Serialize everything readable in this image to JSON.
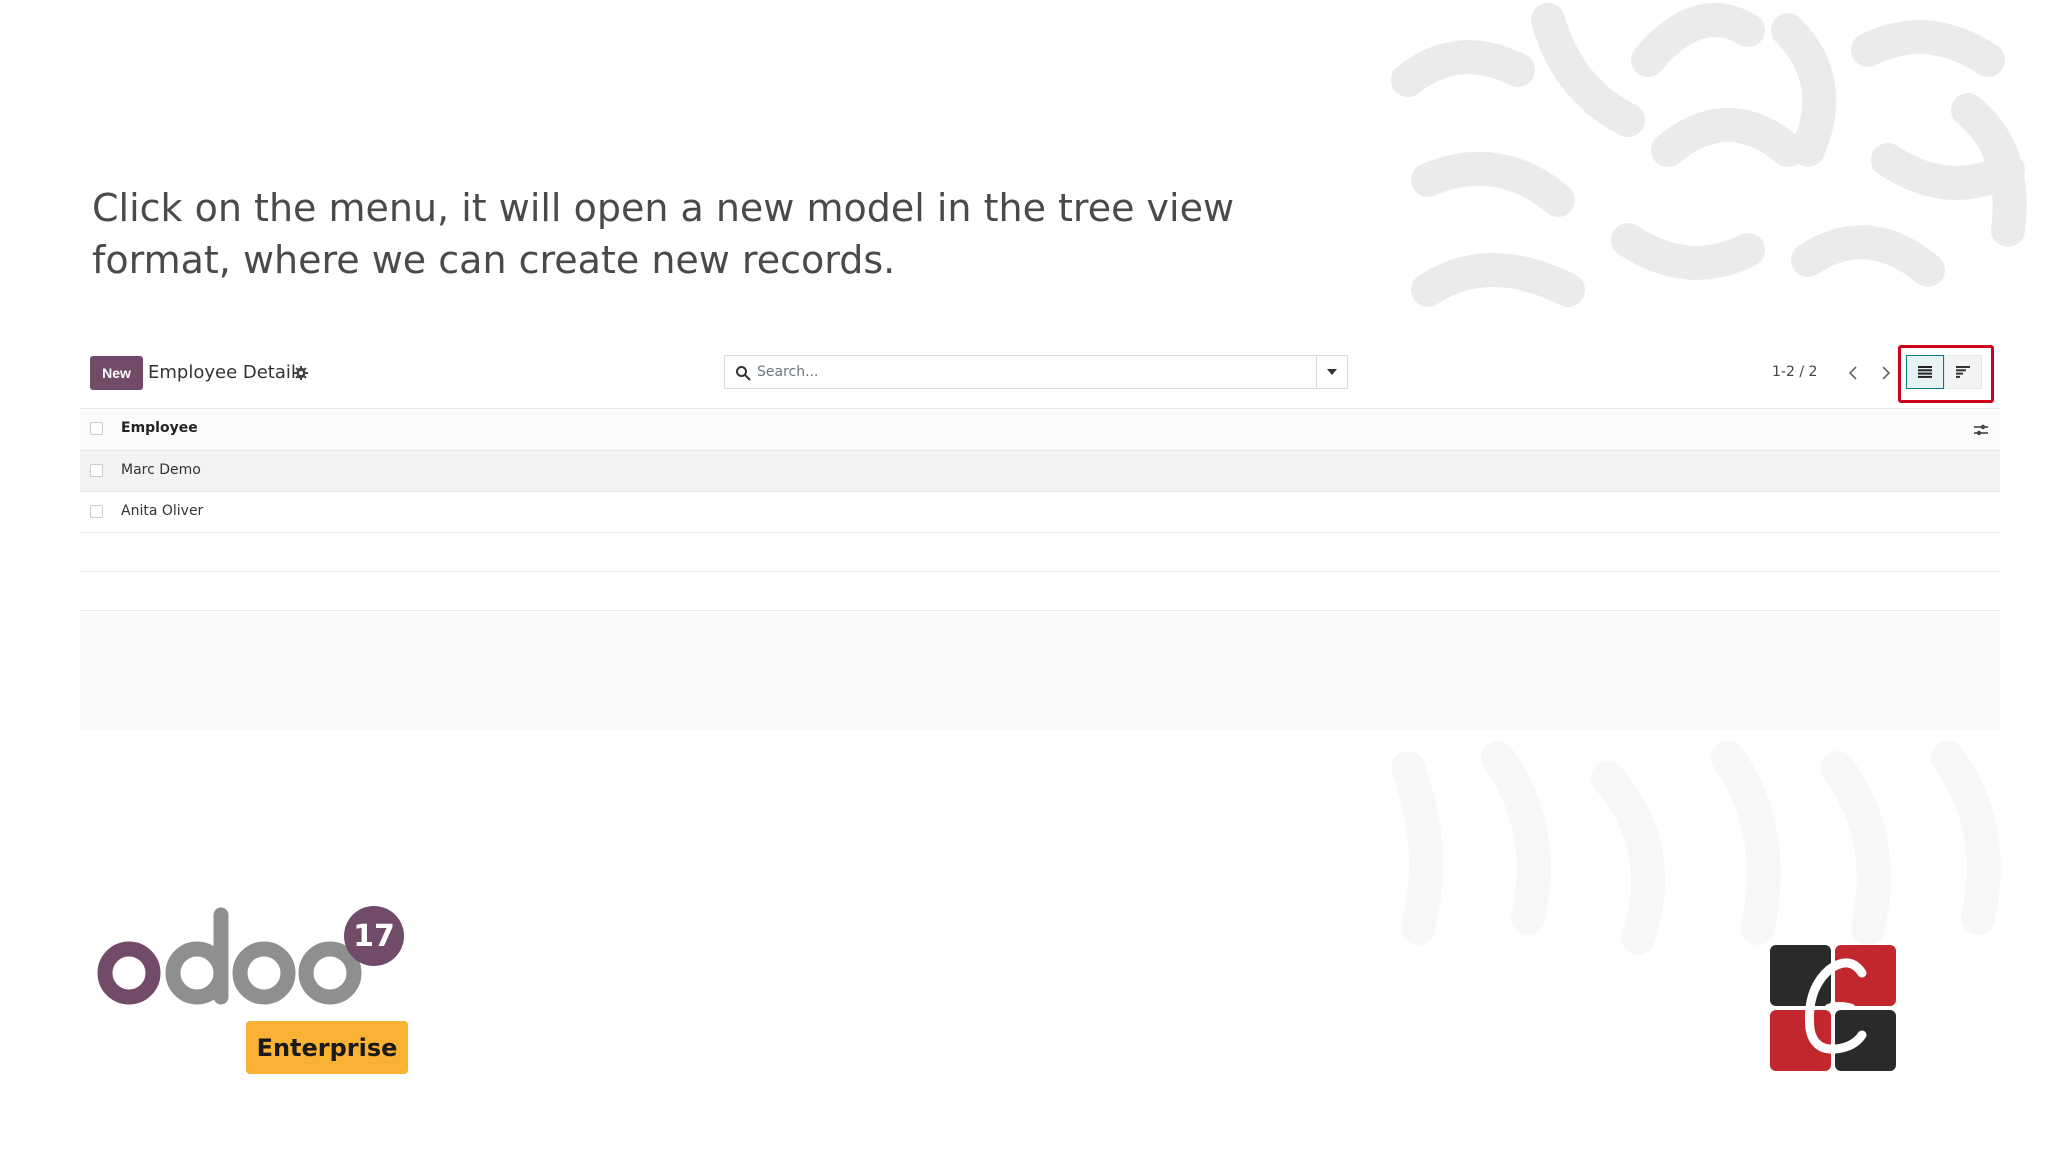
{
  "caption": {
    "line1": "Click on the menu, it will open a new model in the tree view",
    "line2": "format, where we can create new records."
  },
  "control_panel": {
    "new_label": "New",
    "title": "Employee Details",
    "search_placeholder": "Search...",
    "pager": "1-2 / 2"
  },
  "list": {
    "column_header": "Employee",
    "rows": [
      {
        "name": "Marc Demo"
      },
      {
        "name": "Anita Oliver"
      }
    ]
  },
  "branding": {
    "odoo_version": "17",
    "edition": "Enterprise",
    "odoo_purple": "#714b67",
    "odoo_grey": "#8f8f8f",
    "enterprise_color": "#f9b233",
    "highlight_color": "#d0021b"
  },
  "icons": [
    "gear-icon",
    "search-icon",
    "caret-down-icon",
    "chevron-left-icon",
    "chevron-right-icon",
    "list-view-icon",
    "activity-view-icon",
    "column-settings-icon"
  ]
}
